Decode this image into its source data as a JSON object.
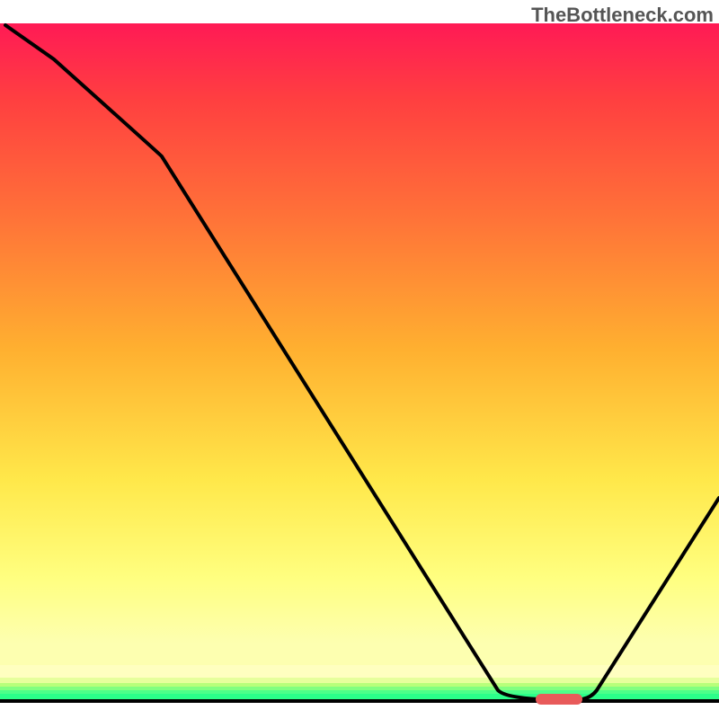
{
  "watermark": "TheBottleneck.com",
  "colors": {
    "top": "#ff1a55",
    "mid1": "#ff8c33",
    "mid2": "#ffd633",
    "mid3": "#fff099",
    "yellow": "#ffff80",
    "green1": "#b6ff70",
    "green2": "#4fff8f",
    "green3": "#2bff8a",
    "line": "#000000",
    "blob": "#e85a5a",
    "bottom_line": "#000000"
  },
  "chart_data": {
    "type": "line",
    "title": "",
    "xlabel": "",
    "ylabel": "",
    "xlim": [
      0,
      100
    ],
    "ylim": [
      0,
      100
    ],
    "series": [
      {
        "name": "penalty-curve",
        "x": [
          0,
          7,
          22,
          69,
          75,
          81,
          100
        ],
        "values": [
          100,
          95,
          76,
          2,
          1,
          1,
          30
        ]
      }
    ],
    "flat_segment": {
      "x_start": 75,
      "x_end": 81,
      "y": 1
    },
    "blob": {
      "x_center": 78,
      "y": 1,
      "width_pct": 5,
      "height_pct": 1.2
    }
  }
}
